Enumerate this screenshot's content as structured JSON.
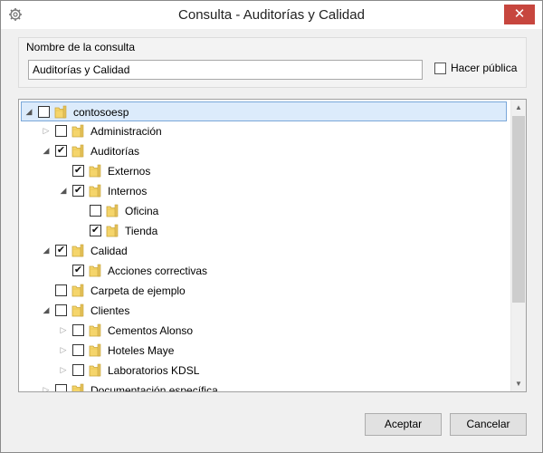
{
  "window": {
    "title": "Consulta - Auditorías y Calidad",
    "icon": "gear-icon",
    "close_label": "✕"
  },
  "query_name": {
    "group_label": "Nombre de la consulta",
    "value": "Auditorías y Calidad",
    "public_label": "Hacer pública",
    "public_checked": false
  },
  "tree": {
    "rows": [
      {
        "label": "contosoesp",
        "level": 0,
        "expander": "expanded",
        "checked": false,
        "selected": true
      },
      {
        "label": "Administración",
        "level": 1,
        "expander": "collapsed",
        "checked": false
      },
      {
        "label": "Auditorías",
        "level": 1,
        "expander": "expanded",
        "checked": true
      },
      {
        "label": "Externos",
        "level": 2,
        "expander": "none",
        "checked": true
      },
      {
        "label": "Internos",
        "level": 2,
        "expander": "expanded",
        "checked": true
      },
      {
        "label": "Oficina",
        "level": 3,
        "expander": "none",
        "checked": false
      },
      {
        "label": "Tienda",
        "level": 3,
        "expander": "none",
        "checked": true
      },
      {
        "label": "Calidad",
        "level": 1,
        "expander": "expanded",
        "checked": true
      },
      {
        "label": "Acciones correctivas",
        "level": 2,
        "expander": "none",
        "checked": true
      },
      {
        "label": "Carpeta de ejemplo",
        "level": 1,
        "expander": "none",
        "checked": false
      },
      {
        "label": "Clientes",
        "level": 1,
        "expander": "expanded",
        "checked": false
      },
      {
        "label": "Cementos Alonso",
        "level": 2,
        "expander": "collapsed",
        "checked": false
      },
      {
        "label": "Hoteles Maye",
        "level": 2,
        "expander": "collapsed",
        "checked": false
      },
      {
        "label": "Laboratorios KDSL",
        "level": 2,
        "expander": "collapsed",
        "checked": false
      },
      {
        "label": "Documentación específica",
        "level": 1,
        "expander": "collapsed",
        "checked": false
      }
    ]
  },
  "buttons": {
    "accept": "Aceptar",
    "cancel": "Cancelar"
  },
  "colors": {
    "selection_bg": "#dcebfb",
    "selection_border": "#7aa7d9",
    "folder_yellow": "#f5d56b",
    "close_red": "#c7463e"
  }
}
